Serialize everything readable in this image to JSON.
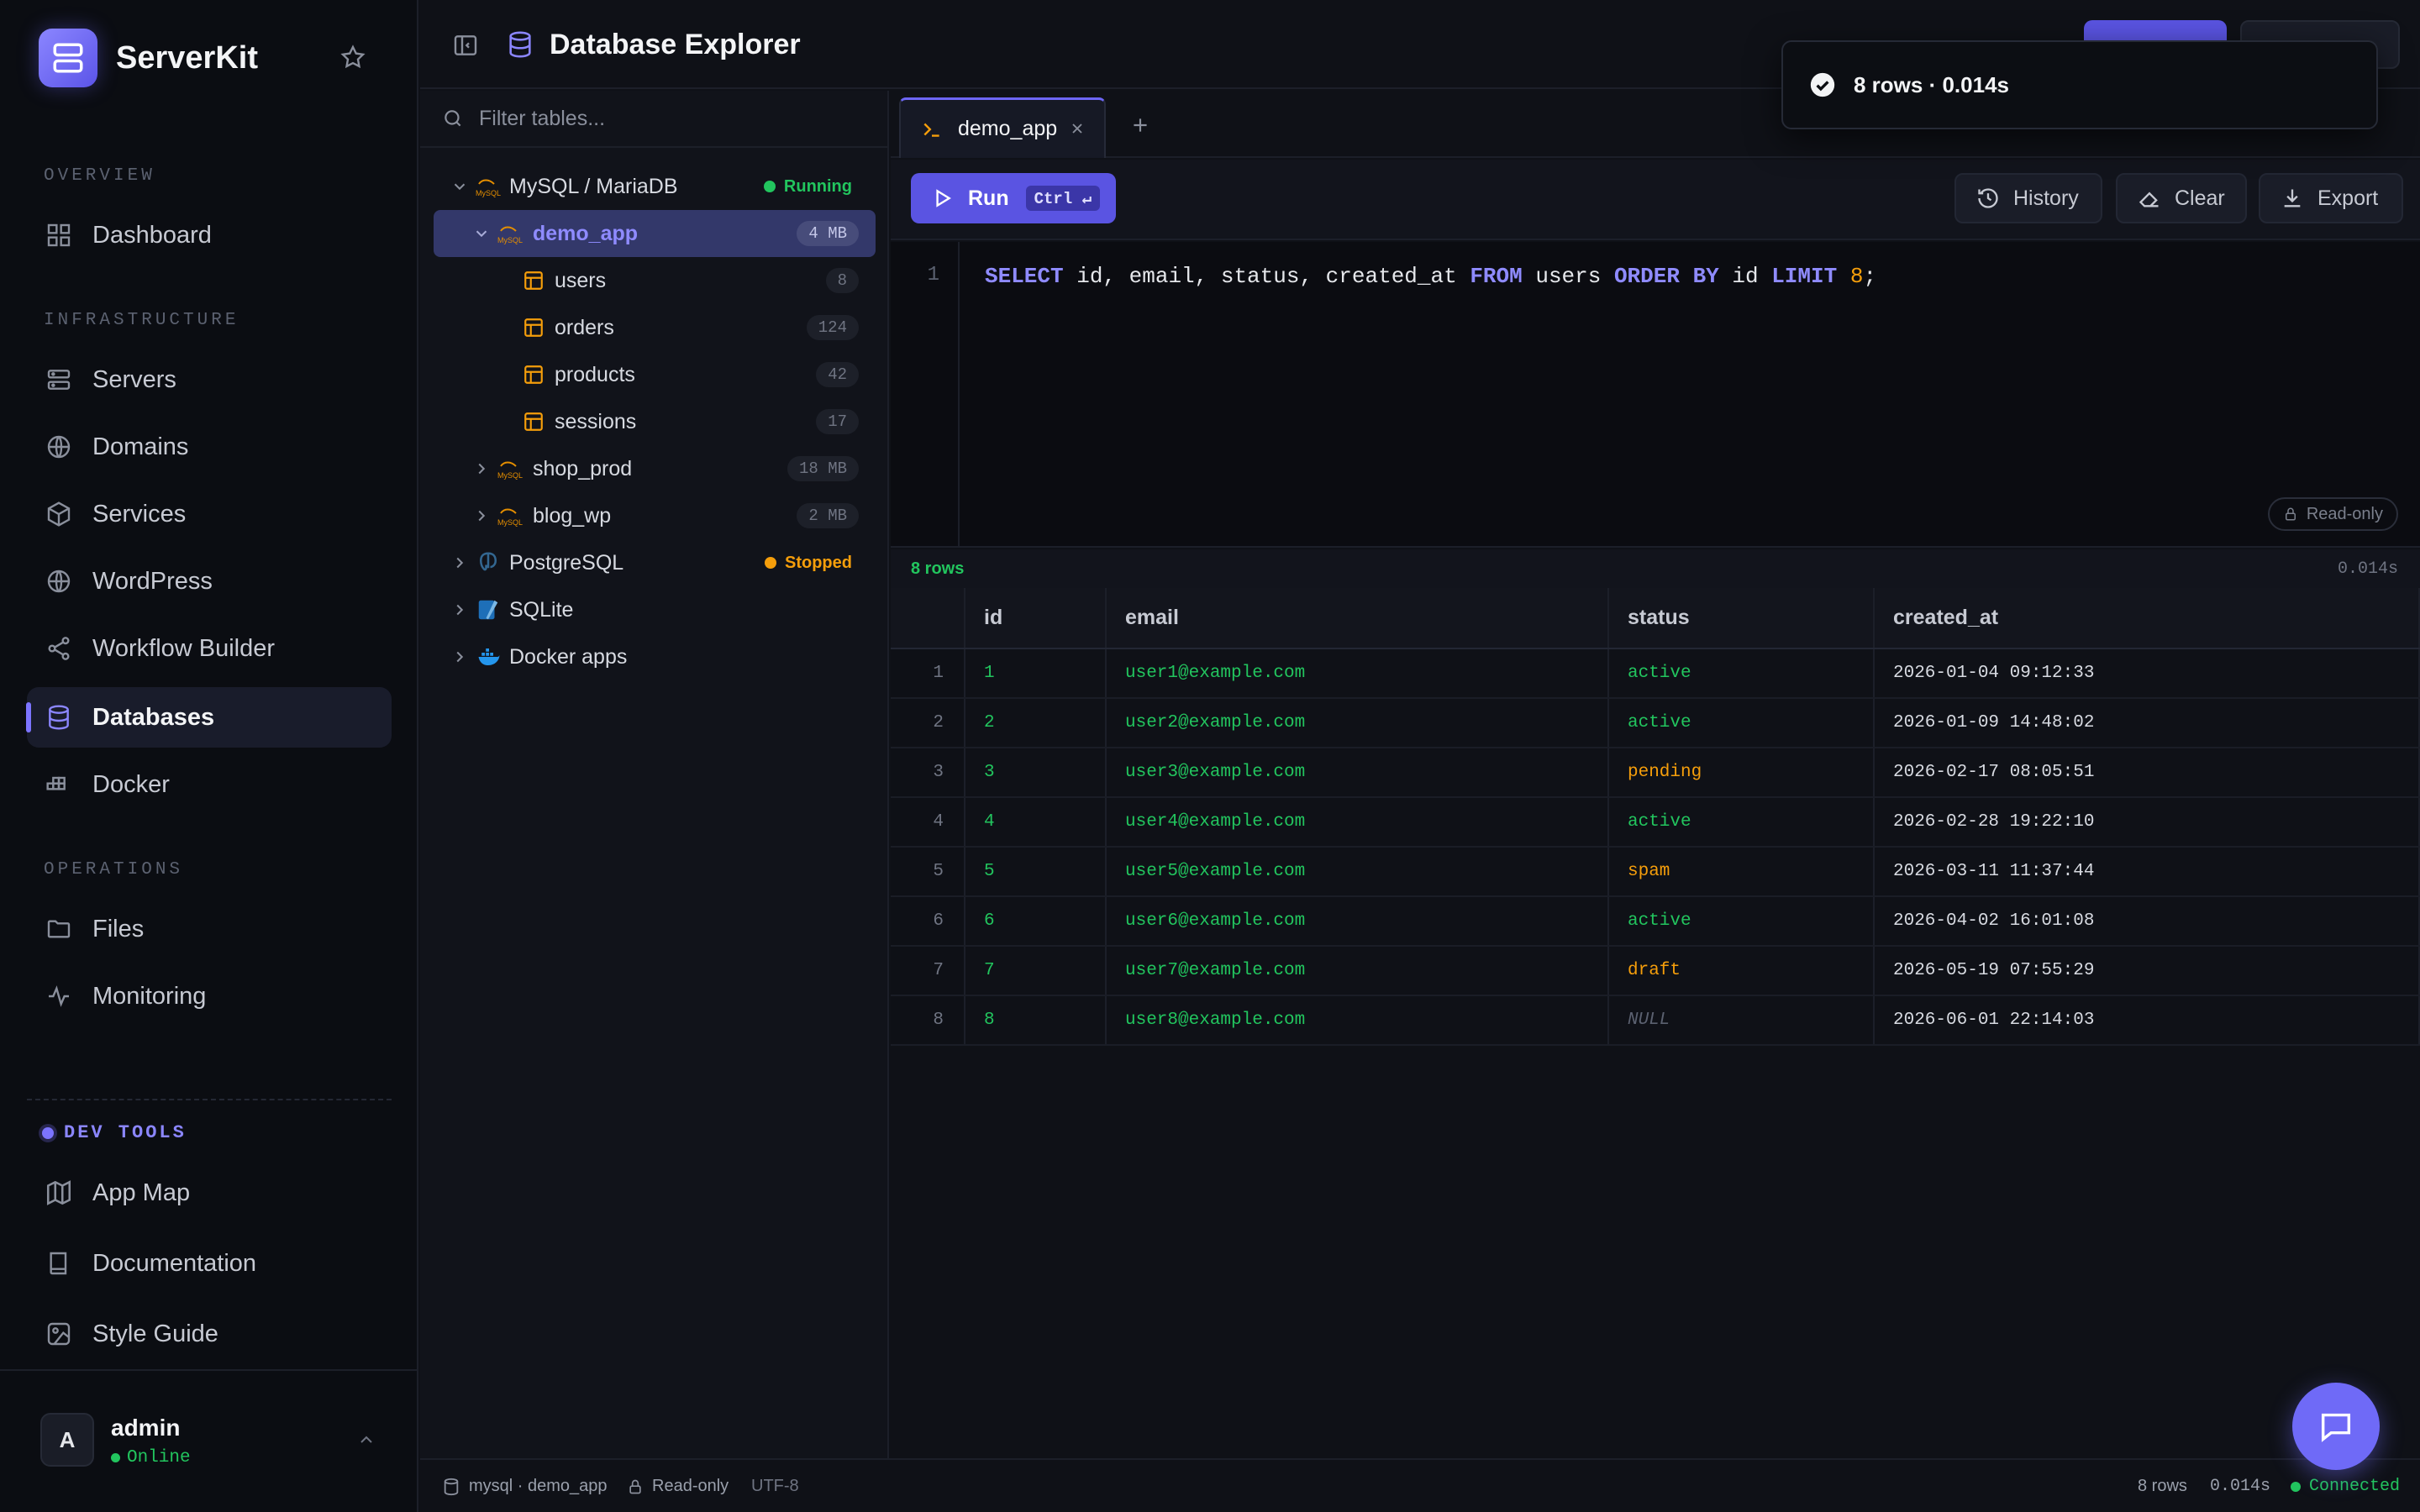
{
  "app": {
    "name": "ServerKit"
  },
  "sidebar": {
    "sections": {
      "overview": "OVERVIEW",
      "infrastructure": "INFRASTRUCTURE",
      "operations": "OPERATIONS",
      "devtools": "DEV TOOLS"
    },
    "items": [
      {
        "label": "Dashboard",
        "icon": "dashboard-grid-icon"
      },
      {
        "label": "Servers",
        "icon": "server-icon"
      },
      {
        "label": "Domains",
        "icon": "globe-icon"
      },
      {
        "label": "Services",
        "icon": "cube-icon"
      },
      {
        "label": "WordPress",
        "icon": "wordpress-icon"
      },
      {
        "label": "Workflow Builder",
        "icon": "share-nodes-icon"
      },
      {
        "label": "Databases",
        "icon": "database-icon",
        "active": true
      },
      {
        "label": "Docker",
        "icon": "docker-icon"
      },
      {
        "label": "Files",
        "icon": "folder-icon"
      },
      {
        "label": "Monitoring",
        "icon": "activity-icon"
      }
    ],
    "devtools": [
      {
        "label": "App Map",
        "icon": "map-icon"
      },
      {
        "label": "Documentation",
        "icon": "book-icon"
      },
      {
        "label": "Style Guide",
        "icon": "palette-icon"
      }
    ],
    "user": {
      "initial": "A",
      "name": "admin",
      "status": "Online"
    }
  },
  "header": {
    "title": "Database Explorer"
  },
  "tree": {
    "filter_placeholder": "Filter tables...",
    "engines": [
      {
        "label": "MySQL / MariaDB",
        "status": "Running"
      },
      {
        "label": "PostgreSQL",
        "status": "Stopped"
      },
      {
        "label": "SQLite"
      },
      {
        "label": "Docker apps"
      }
    ],
    "databases": [
      {
        "label": "demo_app",
        "size": "4 MB"
      },
      {
        "label": "shop_prod",
        "size": "18 MB"
      },
      {
        "label": "blog_wp",
        "size": "2 MB"
      }
    ],
    "tables": [
      {
        "label": "users",
        "count": "8"
      },
      {
        "label": "orders",
        "count": "124"
      },
      {
        "label": "products",
        "count": "42"
      },
      {
        "label": "sessions",
        "count": "17"
      }
    ]
  },
  "editor": {
    "tab_label": "demo_app",
    "run_label": "Run",
    "run_shortcut": "Ctrl ↵",
    "history_label": "History",
    "clear_label": "Clear",
    "export_label": "Export",
    "line_number": "1",
    "query": {
      "t1": "SELECT",
      "t2": " id, email, status, created_at ",
      "t3": "FROM",
      "t4": " users ",
      "t5": "ORDER BY",
      "t6": " id ",
      "t7": "LIMIT",
      "t8": " ",
      "t9": "8",
      "t10": ";"
    },
    "readonly_label": "Read-only"
  },
  "results": {
    "row_count": "8 rows",
    "time": "0.014s",
    "columns": [
      "id",
      "email",
      "status",
      "created_at"
    ],
    "rows": [
      [
        "1",
        "user1@example.com",
        "active",
        "2026-01-04 09:12:33"
      ],
      [
        "2",
        "user2@example.com",
        "active",
        "2026-01-09 14:48:02"
      ],
      [
        "3",
        "user3@example.com",
        "pending",
        "2026-02-17 08:05:51"
      ],
      [
        "4",
        "user4@example.com",
        "active",
        "2026-02-28 19:22:10"
      ],
      [
        "5",
        "user5@example.com",
        "spam",
        "2026-03-11 11:37:44"
      ],
      [
        "6",
        "user6@example.com",
        "active",
        "2026-04-02 16:01:08"
      ],
      [
        "7",
        "user7@example.com",
        "draft",
        "2026-05-19 07:55:29"
      ],
      [
        "8",
        "user8@example.com",
        "NULL",
        "2026-06-01 22:14:03"
      ]
    ]
  },
  "statusbar": {
    "connection": "mysql · demo_app",
    "mode": "Read-only",
    "encoding": "UTF-8",
    "rows": "8 rows",
    "time": "0.014s",
    "state": "Connected"
  },
  "toast": {
    "message": "8 rows · 0.014s"
  },
  "colors": {
    "accent": "#6d66f5",
    "success": "#22c55e",
    "warning": "#f59e0b",
    "background": "#0f1117"
  }
}
